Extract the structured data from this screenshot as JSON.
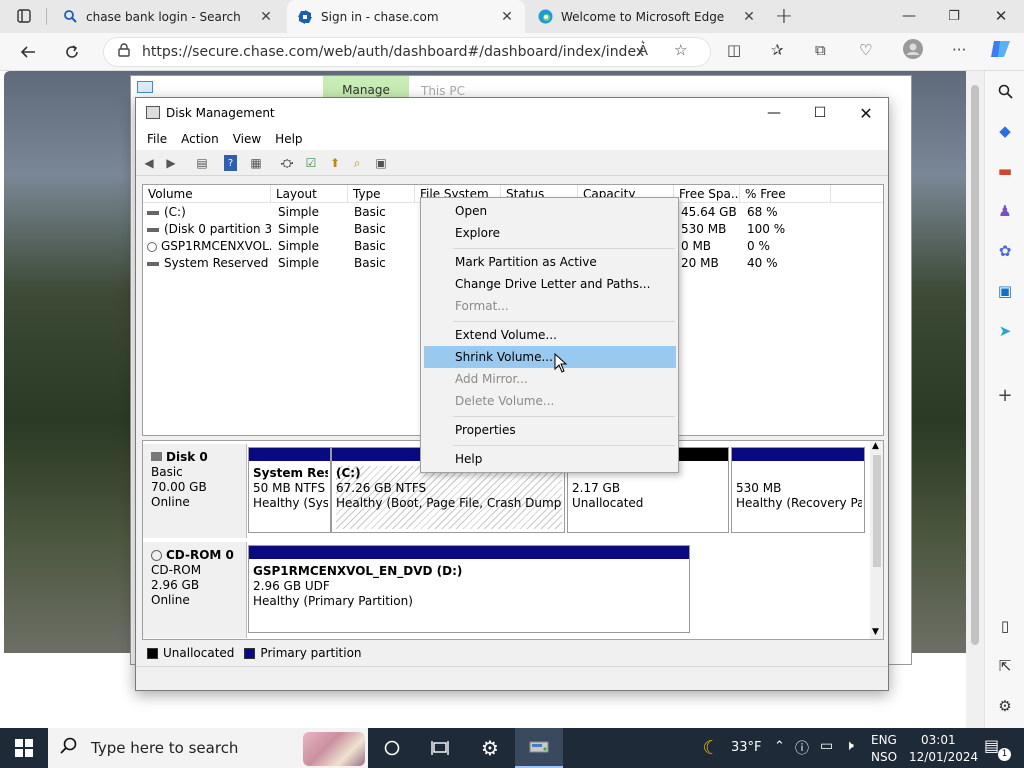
{
  "browser": {
    "tabs": [
      {
        "title": "chase bank login - Search",
        "icon": "search-icon"
      },
      {
        "title": "Sign in - chase.com",
        "icon": "chase-logo-icon"
      },
      {
        "title": "Welcome to Microsoft Edge",
        "icon": "edge-logo-icon"
      }
    ],
    "new_tab_label": "+",
    "url": "https://secure.chase.com/web/auth/dashboard#/dashboard/index/index"
  },
  "explorer_bg": {
    "ribbon_tab": "Manage",
    "title": "This PC"
  },
  "disk_mgmt": {
    "title": "Disk Management",
    "menu": [
      "File",
      "Action",
      "View",
      "Help"
    ],
    "columns": [
      "Volume",
      "Layout",
      "Type",
      "File System",
      "Status",
      "Capacity",
      "Free Spa...",
      "% Free"
    ],
    "volumes": [
      {
        "volume": "(C:)",
        "layout": "Simple",
        "type": "Basic",
        "free": "45.64 GB",
        "pct": "68 %",
        "icon": "drive-icon"
      },
      {
        "volume": "(Disk 0 partition 3)",
        "layout": "Simple",
        "type": "Basic",
        "free": "530 MB",
        "pct": "100 %",
        "icon": "drive-icon"
      },
      {
        "volume": "GSP1RMCENXVOL...",
        "layout": "Simple",
        "type": "Basic",
        "free": "0 MB",
        "pct": "0 %",
        "icon": "cd-drive-icon"
      },
      {
        "volume": "System Reserved",
        "layout": "Simple",
        "type": "Basic",
        "free": "20 MB",
        "pct": "40 %",
        "icon": "drive-icon"
      }
    ],
    "disks": [
      {
        "name": "Disk 0",
        "kind": "Basic",
        "size": "70.00 GB",
        "status": "Online",
        "partitions": [
          {
            "name": "System Rese",
            "detail": "50 MB NTFS",
            "health": "Healthy (Syst"
          },
          {
            "name": "(C:)",
            "detail": "67.26 GB NTFS",
            "health": "Healthy (Boot, Page File, Crash Dump, Pri"
          },
          {
            "name": "",
            "detail": "2.17 GB",
            "health": "Unallocated"
          },
          {
            "name": "",
            "detail": "530 MB",
            "health": "Healthy (Recovery Part"
          }
        ]
      },
      {
        "name": "CD-ROM 0",
        "kind": "CD-ROM",
        "size": "2.96 GB",
        "status": "Online",
        "partitions": [
          {
            "name": "GSP1RMCENXVOL_EN_DVD  (D:)",
            "detail": "2.96 GB UDF",
            "health": "Healthy (Primary Partition)"
          }
        ]
      }
    ],
    "legend": [
      {
        "label": "Unallocated",
        "color": "#000000"
      },
      {
        "label": "Primary partition",
        "color": "#0a0a80"
      }
    ]
  },
  "context_menu": {
    "items": [
      {
        "label": "Open",
        "enabled": true
      },
      {
        "label": "Explore",
        "enabled": true
      },
      {
        "label": "Mark Partition as Active",
        "enabled": true
      },
      {
        "label": "Change Drive Letter and Paths...",
        "enabled": true
      },
      {
        "label": "Format...",
        "enabled": false
      },
      {
        "label": "Extend Volume...",
        "enabled": true
      },
      {
        "label": "Shrink Volume...",
        "enabled": true,
        "highlighted": true
      },
      {
        "label": "Add Mirror...",
        "enabled": false
      },
      {
        "label": "Delete Volume...",
        "enabled": false
      },
      {
        "label": "Properties",
        "enabled": true
      },
      {
        "label": "Help",
        "enabled": true
      }
    ]
  },
  "taskbar": {
    "search_placeholder": "Type here to search",
    "weather": "33°F",
    "lang_top": "ENG",
    "lang_bottom": "NSO",
    "time": "03:01",
    "date": "12/01/2024",
    "notif_count": "1"
  },
  "colors": {
    "accent": "#0a0a80",
    "highlight": "#99c9ef",
    "taskbar": "#1f2a38"
  }
}
